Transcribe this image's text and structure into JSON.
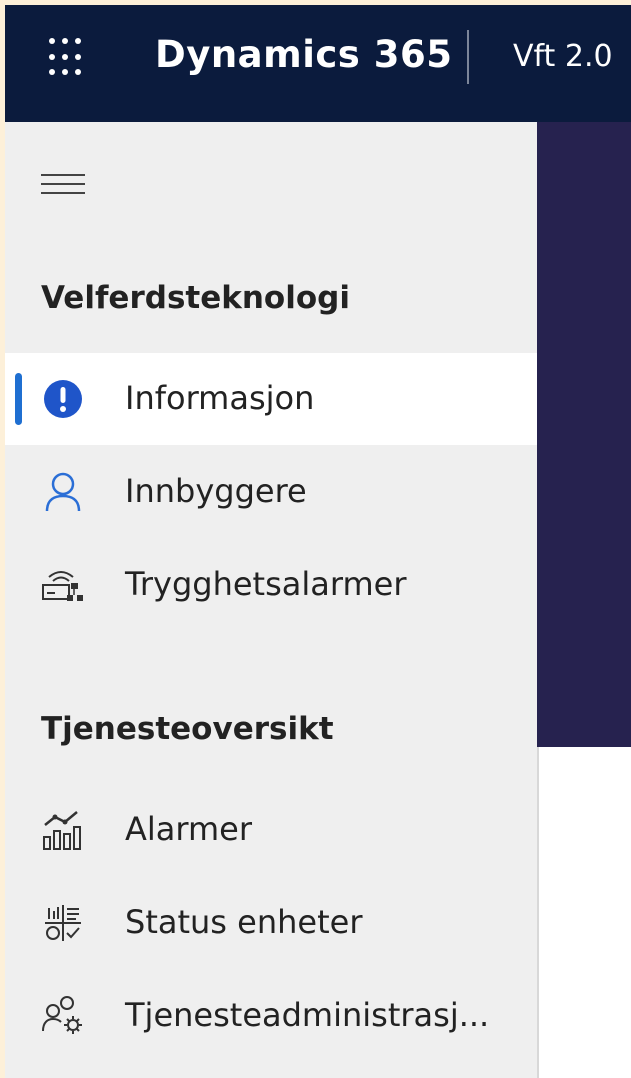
{
  "header": {
    "app_launcher_icon": "waffle-icon",
    "product_title": "Dynamics 365",
    "app_name": "Vft 2.0"
  },
  "sidebar": {
    "toggle_icon": "hamburger-icon",
    "sections": [
      {
        "title": "Velferdsteknologi",
        "items": [
          {
            "label": "Informasjon",
            "icon": "info-circle-icon",
            "selected": true
          },
          {
            "label": "Innbyggere",
            "icon": "person-icon",
            "selected": false
          },
          {
            "label": "Trygghetsalarmer",
            "icon": "alarm-device-network-icon",
            "selected": false
          }
        ]
      },
      {
        "title": "Tjenesteoversikt",
        "items": [
          {
            "label": "Alarmer",
            "icon": "chart-trend-icon",
            "selected": false
          },
          {
            "label": "Status enheter",
            "icon": "status-grid-icon",
            "selected": false
          },
          {
            "label": "Tjenesteadministrasj...",
            "icon": "people-settings-icon",
            "selected": false
          }
        ]
      }
    ]
  },
  "colors": {
    "topbar": "#0b1b3d",
    "sidebar_bg": "#efefef",
    "accent": "#1f6fd1",
    "main_banner": "#26224f"
  }
}
